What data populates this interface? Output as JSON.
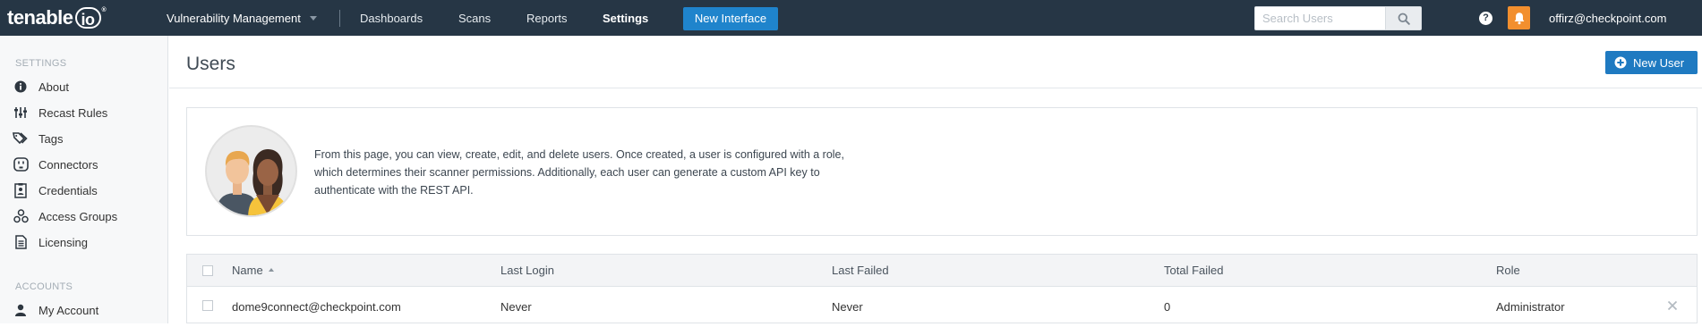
{
  "topnav": {
    "logo_text": "tenable",
    "logo_suffix": "io",
    "logo_tm": "®",
    "product_menu": "Vulnerability Management",
    "items": [
      "Dashboards",
      "Scans",
      "Reports",
      "Settings"
    ],
    "active_item": "Settings",
    "new_interface_label": "New Interface",
    "search_placeholder": "Search Users",
    "help_label": "?",
    "user_email": "offirz@checkpoint.com",
    "accent_color": "#1f84cc",
    "notification_color": "#f28f2e"
  },
  "sidebar": {
    "settings_heading": "SETTINGS",
    "settings_items": [
      {
        "label": "About",
        "icon": "info-icon"
      },
      {
        "label": "Recast Rules",
        "icon": "sliders-icon"
      },
      {
        "label": "Tags",
        "icon": "tags-icon"
      },
      {
        "label": "Connectors",
        "icon": "plug-icon"
      },
      {
        "label": "Credentials",
        "icon": "id-card-icon"
      },
      {
        "label": "Access Groups",
        "icon": "groups-icon"
      },
      {
        "label": "Licensing",
        "icon": "document-icon"
      }
    ],
    "accounts_heading": "ACCOUNTS",
    "accounts_items": [
      {
        "label": "My Account",
        "icon": "user-icon"
      }
    ]
  },
  "main": {
    "title": "Users",
    "new_user_label": "New User",
    "info_text": "From this page, you can view, create, edit, and delete users. Once created, a user is configured with a role, which determines their scanner permissions. Additionally, each user can generate a custom API key to authenticate with the REST API.",
    "table": {
      "columns": [
        "Name",
        "Last Login",
        "Last Failed",
        "Total Failed",
        "Role"
      ],
      "sorted_column": "Name",
      "rows": [
        {
          "name": "dome9connect@checkpoint.com",
          "last_login": "Never",
          "last_failed": "Never",
          "total_failed": "0",
          "role": "Administrator"
        }
      ]
    }
  }
}
